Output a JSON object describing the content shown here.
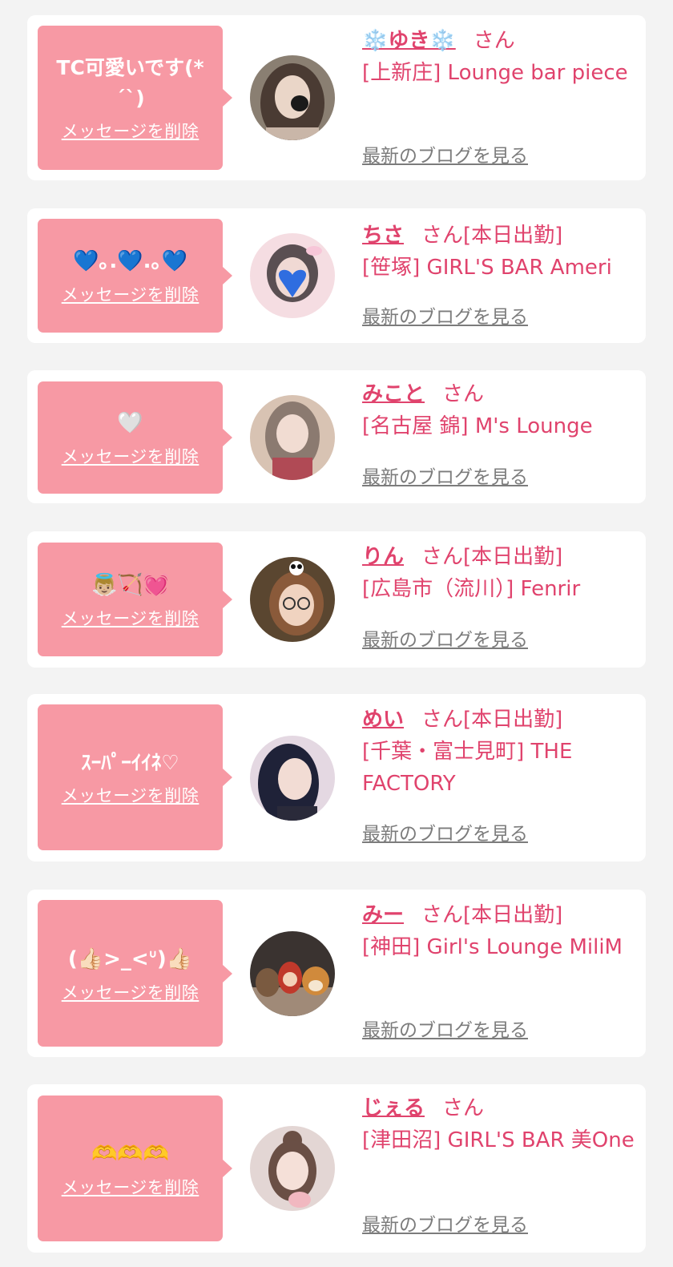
{
  "items": [
    {
      "message": "TC可愛いです(*´`)",
      "delete_label": "メッセージを削除",
      "name": "❄️ゆき❄️",
      "honorific": "さん",
      "status": "",
      "shop": "[上新庄] Lounge bar piece",
      "blog_label": "最新のブログを見る",
      "avatar_icon": "girl-photo-avatar"
    },
    {
      "message": "💙｡.💙.｡💙",
      "delete_label": "メッセージを削除",
      "name": "ちさ",
      "honorific": "さん",
      "status": "[本日出勤]",
      "shop": "[笹塚] GIRL'S BAR Ameri",
      "blog_label": "最新のブログを見る",
      "avatar_icon": "girl-photo-avatar"
    },
    {
      "message": "🤍",
      "delete_label": "メッセージを削除",
      "name": "みこと",
      "honorific": "さん",
      "status": "",
      "shop": "[名古屋 錦] M's Lounge",
      "blog_label": "最新のブログを見る",
      "avatar_icon": "girl-photo-avatar"
    },
    {
      "message": "👼🏼🏹💓",
      "delete_label": "メッセージを削除",
      "name": "りん",
      "honorific": "さん",
      "status": "[本日出勤]",
      "shop": "[広島市（流川）] Fenrir",
      "blog_label": "最新のブログを見る",
      "avatar_icon": "girl-photo-avatar"
    },
    {
      "message": "ｽｰﾊﾟｰｲｲﾈ♡",
      "delete_label": "メッセージを削除",
      "name": "めい",
      "honorific": "さん",
      "status": "[本日出勤]",
      "shop": "[千葉・富士見町] THE FACTORY",
      "blog_label": "最新のブログを見る",
      "avatar_icon": "girl-photo-avatar"
    },
    {
      "message": "(👍🏻>_<ᐡ)👍🏻",
      "delete_label": "メッセージを削除",
      "name": "みー",
      "honorific": "さん",
      "status": "[本日出勤]",
      "shop": "[神田] Girl's Lounge MiliM",
      "blog_label": "最新のブログを見る",
      "avatar_icon": "plush-toys-avatar"
    },
    {
      "message": "🫶🫶🫶",
      "delete_label": "メッセージを削除",
      "name": "じぇる",
      "honorific": "さん",
      "status": "",
      "shop": "[津田沼] GIRL'S BAR 美One",
      "blog_label": "最新のブログを見る",
      "avatar_icon": "girl-photo-avatar"
    }
  ],
  "colors": {
    "accent": "#e0436d",
    "bubble": "#f799a4",
    "page_bg": "#f3f3f3",
    "link_gray": "#7c7c7c"
  }
}
